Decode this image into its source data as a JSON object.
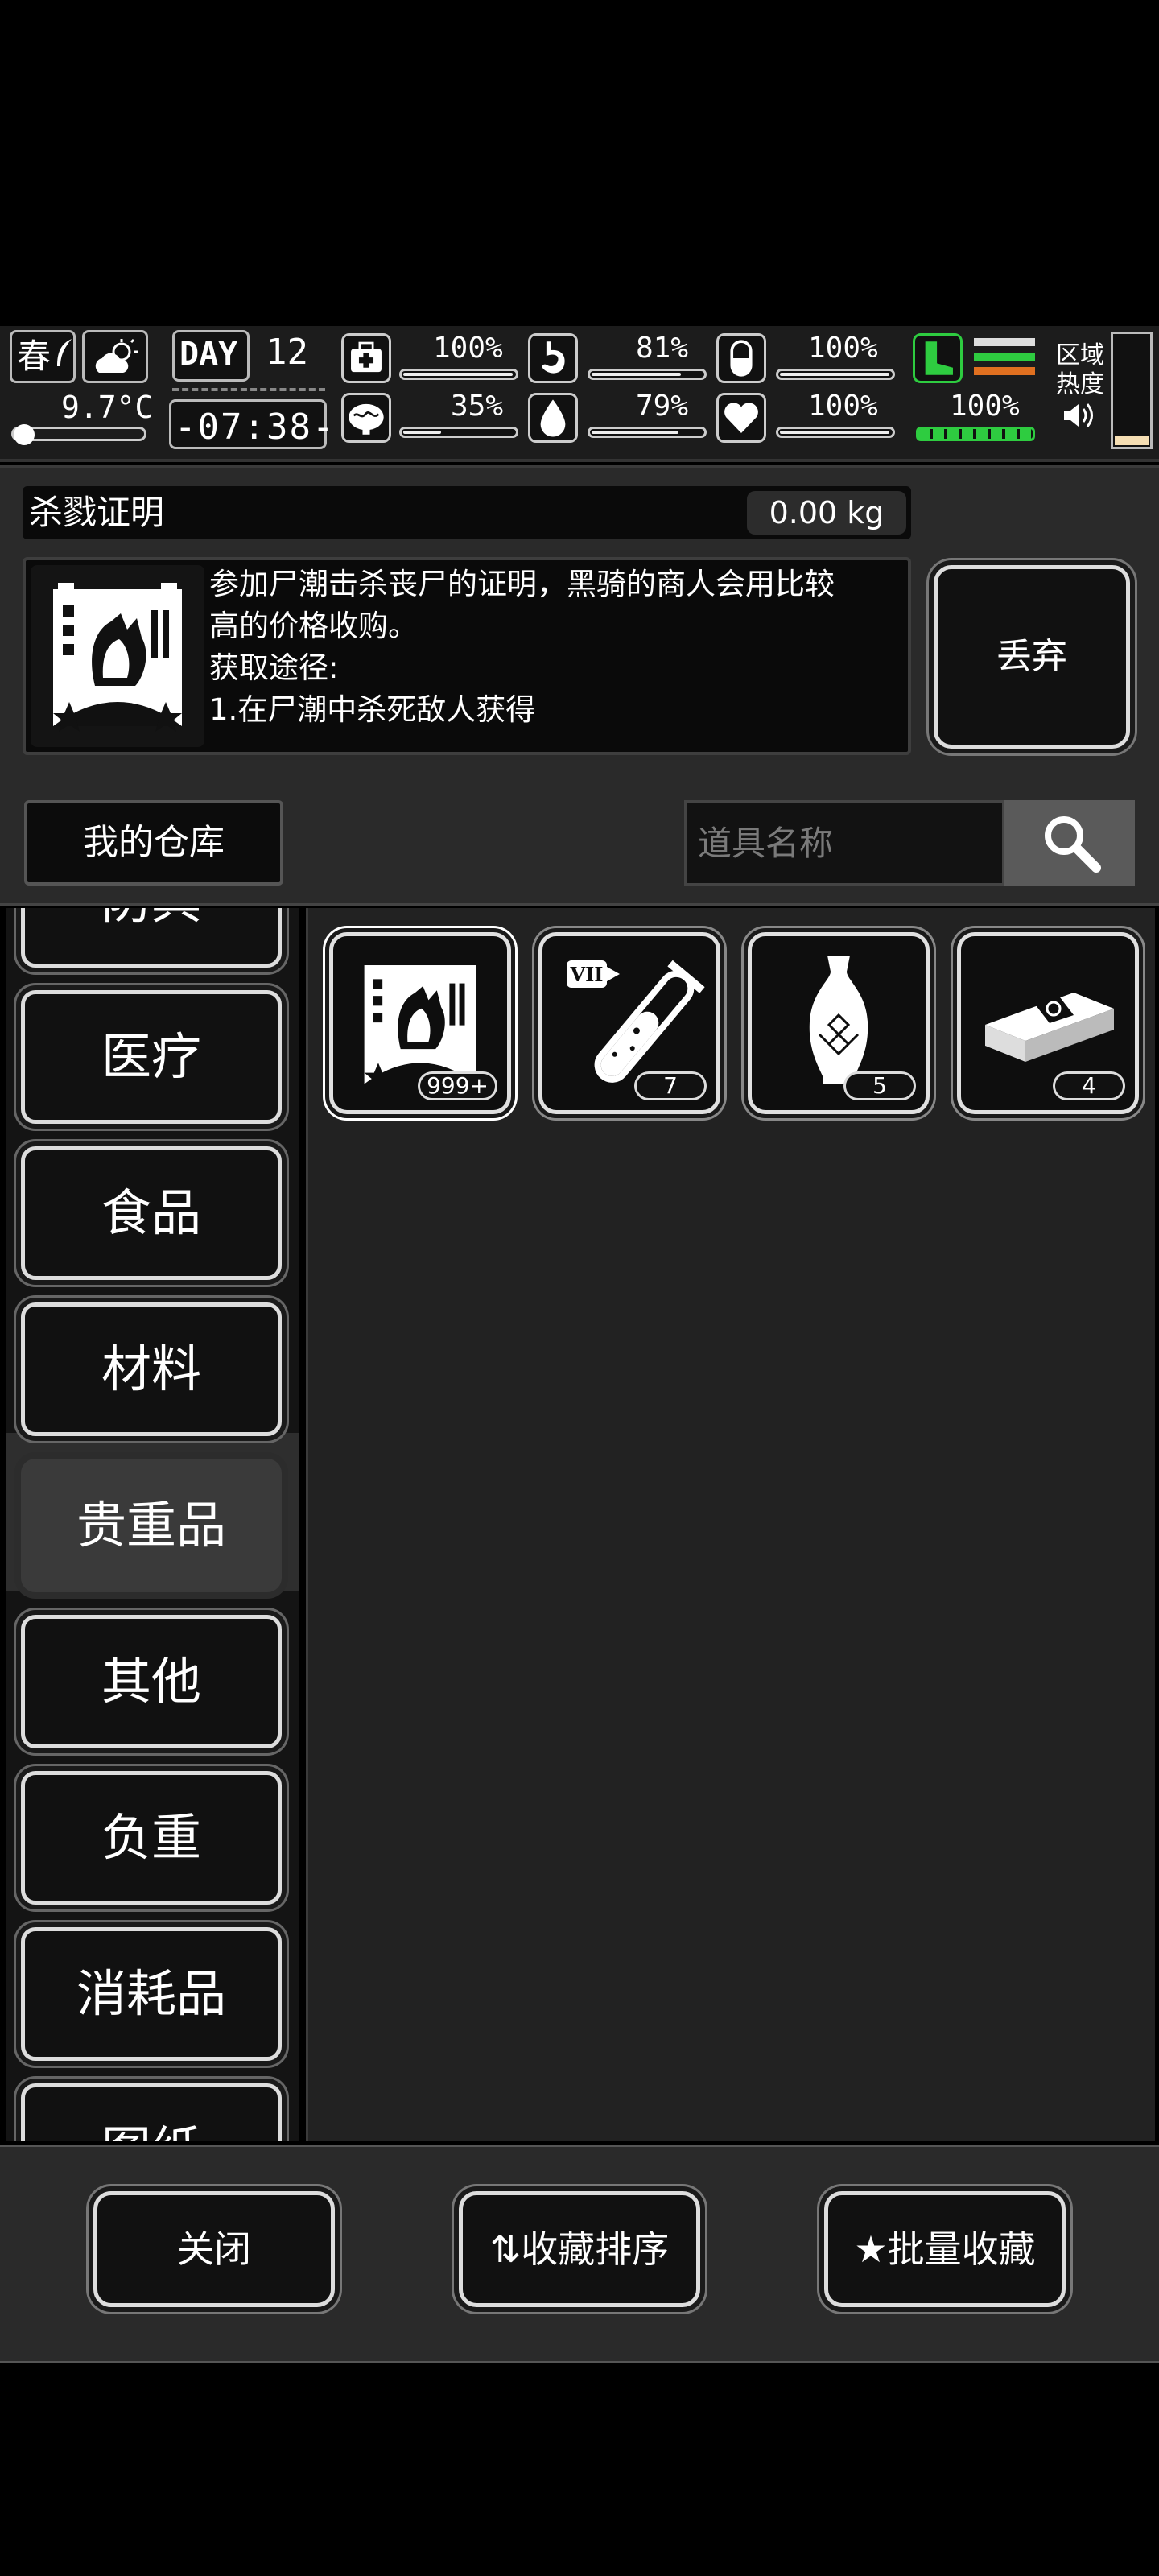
{
  "hud": {
    "season": "春",
    "temperature": "9.7°C",
    "day_label": "DAY",
    "day_number": "12",
    "clock": "-07:38-",
    "stats": [
      {
        "name": "health",
        "icon": "medkit-icon",
        "value": "100%",
        "level": 1.0
      },
      {
        "name": "hunger",
        "icon": "stomach-icon",
        "value": "81%",
        "level": 0.81
      },
      {
        "name": "immunity",
        "icon": "pill-icon",
        "value": "100%",
        "level": 1.0
      },
      {
        "name": "mental",
        "icon": "brain-icon",
        "value": "35%",
        "level": 0.35
      },
      {
        "name": "thirst",
        "icon": "water-drop-icon",
        "value": "79%",
        "level": 0.79
      },
      {
        "name": "mood",
        "icon": "heart-icon",
        "value": "100%",
        "level": 1.0
      }
    ],
    "stamina": "100%",
    "zone_heat_label": "区域\n热度",
    "colors": {
      "green": "#2ecc40",
      "orange": "#e07020",
      "heat": "#f5deb3"
    }
  },
  "detail": {
    "title": "杀戮证明",
    "weight": "0.00 kg",
    "description": "参加尸潮击杀丧尸的证明，黑骑的商人会用比较\n高的价格收购。\n获取途径:\n1.在尸潮中杀死敌人获得",
    "discard_label": "丢弃"
  },
  "warehouse": {
    "title": "我的仓库",
    "search_placeholder": "道具名称"
  },
  "categories": [
    {
      "label": "防具",
      "active": false
    },
    {
      "label": "医疗",
      "active": false
    },
    {
      "label": "食品",
      "active": false
    },
    {
      "label": "材料",
      "active": false
    },
    {
      "label": "贵重品",
      "active": true
    },
    {
      "label": "其他",
      "active": false
    },
    {
      "label": "负重",
      "active": false
    },
    {
      "label": "消耗品",
      "active": false
    },
    {
      "label": "图纸",
      "active": false
    }
  ],
  "items": [
    {
      "name": "kill-proof-card",
      "count": "999+"
    },
    {
      "name": "test-tube-vii",
      "count": "7"
    },
    {
      "name": "porcelain-vase",
      "count": "5"
    },
    {
      "name": "cash-bundle",
      "count": "4"
    }
  ],
  "footer": {
    "close_label": "关闭",
    "sort_label": "收藏排序",
    "batch_fav_label": "批量收藏"
  }
}
